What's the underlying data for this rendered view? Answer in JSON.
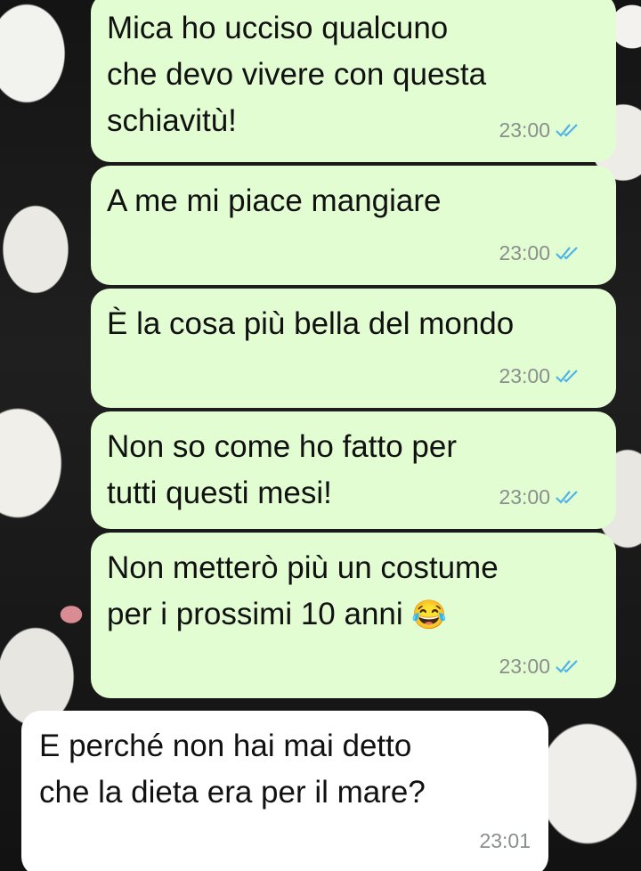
{
  "theme": {
    "outgoing_bubble": "#e2fdd2",
    "incoming_bubble": "#ffffff",
    "read_tick_color": "#4fb3e8"
  },
  "messages": [
    {
      "direction": "out",
      "text_lines": [
        "Mica ho ucciso qualcuno",
        "che devo vivere con questa",
        "schiavitù!"
      ],
      "time": "23:00",
      "status": "read-double-check-icon"
    },
    {
      "direction": "out",
      "text_lines": [
        "A me mi piace mangiare"
      ],
      "time": "23:00",
      "status": "read-double-check-icon"
    },
    {
      "direction": "out",
      "text_lines": [
        "È la cosa più bella del mondo"
      ],
      "time": "23:00",
      "status": "read-double-check-icon"
    },
    {
      "direction": "out",
      "text_lines": [
        "Non so come ho fatto per",
        "tutti questi mesi!"
      ],
      "time": "23:00",
      "status": "read-double-check-icon"
    },
    {
      "direction": "out",
      "text_lines": [
        "Non metterò più un costume",
        "per i prossimi 10 anni"
      ],
      "emoji": "😂",
      "time": "23:00",
      "status": "read-double-check-icon"
    },
    {
      "direction": "in",
      "text_lines": [
        "E perché non hai mai detto",
        "che la dieta era per il mare?"
      ],
      "time": "23:01"
    }
  ]
}
